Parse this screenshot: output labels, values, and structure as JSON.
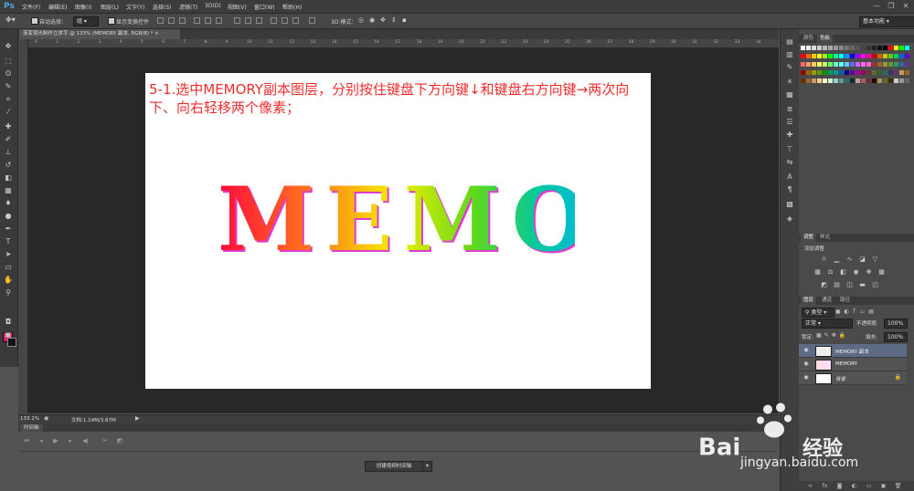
{
  "app": {
    "logo": "Ps"
  },
  "menu": [
    "文件(F)",
    "编辑(E)",
    "图像(I)",
    "图层(L)",
    "文字(Y)",
    "选择(S)",
    "滤镜(T)",
    "3D(D)",
    "视图(V)",
    "窗口(W)",
    "帮助(H)"
  ],
  "window_controls": {
    "minimize": "—",
    "restore": "❐",
    "close": "✕"
  },
  "options": {
    "auto_select_label": "自动选择：",
    "auto_select_value": "组",
    "show_transform_label": "显示变换控件",
    "mode_3d_label": "3D 模式：",
    "workspace": "基本功能"
  },
  "document": {
    "tab_title": "渐变镜光制作立体字 @ 133% (MEMORY 副本, RGB/8) *",
    "instruction": "5-1.选中MEMORY副本图层，分别按住键盘下方向键↓和键盘右方向键→两次向下、向右轻移两个像素；",
    "art_text": "MEMORY"
  },
  "ruler_ticks": [
    "0",
    "1",
    "2",
    "3",
    "4",
    "5",
    "6",
    "7",
    "8",
    "9",
    "10",
    "11",
    "12",
    "13",
    "14",
    "15",
    "16",
    "17",
    "18",
    "19",
    "20",
    "21",
    "22",
    "23",
    "24",
    "25",
    "26",
    "27",
    "28",
    "29",
    "30",
    "31",
    "32",
    "33",
    "34"
  ],
  "status": {
    "zoom": "133.1%",
    "doc_info": "文档:1.14M/3.87M"
  },
  "timeline": {
    "tab": "时间轴",
    "create_button": "创建视频时间轴"
  },
  "panels": {
    "color_tabs": [
      "颜色",
      "色板"
    ],
    "adjust_tabs": [
      "调整",
      "样式"
    ],
    "adjust_title": "添加调整",
    "layers_tabs": [
      "图层",
      "通道",
      "路径"
    ],
    "layer_kind": "类型",
    "blend_mode": "正常",
    "opacity_label": "不透明度:",
    "opacity_value": "100%",
    "lock_label": "锁定:",
    "fill_label": "填充:",
    "fill_value": "100%",
    "layers": [
      {
        "name": "MEMORY 副本",
        "selected": true
      },
      {
        "name": "MEMORY",
        "selected": false
      },
      {
        "name": "背景",
        "selected": false
      }
    ]
  },
  "watermark": {
    "url": "jingyan.baidu.com"
  },
  "colors": {
    "foreground": "#e8156e",
    "background": "#111111",
    "instruction_text": "#ee2d2d",
    "selection": "#5d6b84"
  }
}
